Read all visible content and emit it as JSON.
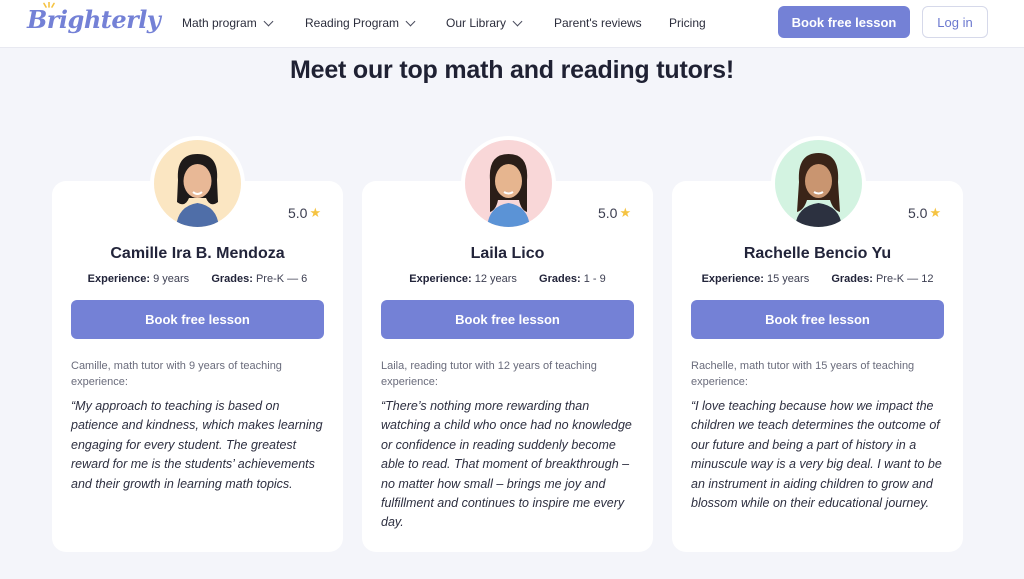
{
  "nav": {
    "logo": "Brighterly",
    "items": [
      {
        "label": "Math program",
        "dropdown": true
      },
      {
        "label": "Reading Program",
        "dropdown": true
      },
      {
        "label": "Our Library",
        "dropdown": true
      },
      {
        "label": "Parent's reviews",
        "dropdown": false
      },
      {
        "label": "Pricing",
        "dropdown": false
      }
    ],
    "book_label": "Book free lesson",
    "login_label": "Log in"
  },
  "heading": "Meet our top math and reading tutors!",
  "colors": {
    "accent": "#7481d6",
    "star": "#f5c342",
    "background": "#f4f5fa"
  },
  "tutors": [
    {
      "name": "Camille Ira B. Mendoza",
      "rating": "5.0",
      "experience_label": "Experience:",
      "experience": "9 years",
      "grades_label": "Grades:",
      "grades": "Pre-K — 6",
      "button": "Book free lesson",
      "intro": "Camille, math tutor with 9 years of teaching experience:",
      "quote": "“My approach to teaching is based on patience and kindness, which makes learning engaging for every student. The greatest reward for me is the students’ achievements and their growth in learning math topics.",
      "avatar_bg": "#fbe6c2"
    },
    {
      "name": "Laila Lico",
      "rating": "5.0",
      "experience_label": "Experience:",
      "experience": "12 years",
      "grades_label": "Grades:",
      "grades": "1 - 9",
      "button": "Book free lesson",
      "intro": "Laila, reading tutor with 12 years of teaching experience:",
      "quote": "“There’s nothing more rewarding than watching a child who once had no knowledge or confidence in reading suddenly become able to read. That moment of breakthrough – no matter how small – brings me joy and fulfillment and continues to inspire me every day.",
      "avatar_bg": "#f9d7d8"
    },
    {
      "name": "Rachelle Bencio Yu",
      "rating": "5.0",
      "experience_label": "Experience:",
      "experience": "15 years",
      "grades_label": "Grades:",
      "grades": "Pre-K — 12",
      "button": "Book free lesson",
      "intro": "Rachelle, math tutor with 15 years of teaching experience:",
      "quote": "“I love teaching because how we impact the children we teach determines the outcome of our future and being a part of history in a minuscule way is a very big deal. I want to be an instrument in aiding children to grow and blossom while on their educational journey.",
      "avatar_bg": "#d3f3e1"
    }
  ]
}
